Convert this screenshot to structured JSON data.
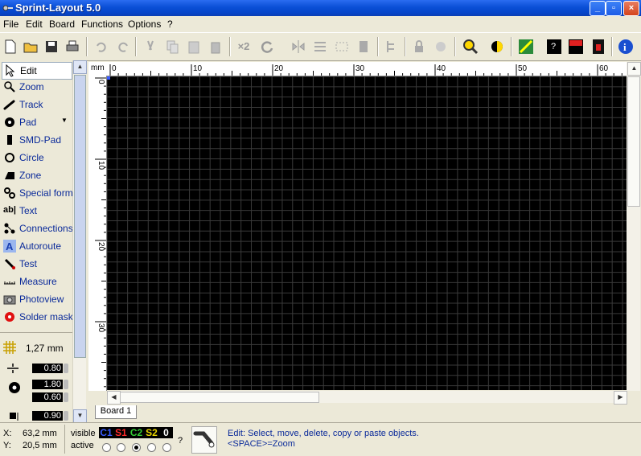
{
  "window": {
    "title": "Sprint-Layout 5.0",
    "buttons": [
      "_",
      "▫",
      "×"
    ]
  },
  "menu": [
    "File",
    "Edit",
    "Board",
    "Functions",
    "Options",
    "?"
  ],
  "toolbar": {
    "x2_label": "×2"
  },
  "tools": [
    {
      "label": "Edit",
      "icon": "arrow-cursor-icon",
      "active": true
    },
    {
      "label": "Zoom",
      "icon": "magnifier-icon"
    },
    {
      "label": "Track",
      "icon": "track-icon"
    },
    {
      "label": "Pad",
      "icon": "pad-icon",
      "has_menu": true
    },
    {
      "label": "SMD-Pad",
      "icon": "smd-pad-icon"
    },
    {
      "label": "Circle",
      "icon": "circle-icon"
    },
    {
      "label": "Zone",
      "icon": "zone-icon"
    },
    {
      "label": "Special form",
      "icon": "special-form-icon"
    },
    {
      "label": "Text",
      "icon": "text-icon"
    },
    {
      "label": "Connections",
      "icon": "connections-icon"
    },
    {
      "label": "Autoroute",
      "icon": "autoroute-icon"
    },
    {
      "label": "Test",
      "icon": "test-icon"
    },
    {
      "label": "Measure",
      "icon": "measure-icon"
    },
    {
      "label": "Photoview",
      "icon": "camera-icon"
    },
    {
      "label": "Solder mask",
      "icon": "solder-mask-icon"
    }
  ],
  "grid_setting": {
    "value": "1,27 mm"
  },
  "params": [
    {
      "value": "0.80",
      "icon": "track-width-icon"
    },
    {
      "value": "1.80",
      "icon": "pad-outer-icon"
    },
    {
      "value": "0.60",
      "icon": "pad-drill-icon"
    },
    {
      "value": "0.90",
      "icon": "smd-size-icon"
    }
  ],
  "ruler": {
    "unit": "mm",
    "top_labels": [
      "0",
      "10",
      "20",
      "30",
      "40",
      "50",
      "60"
    ],
    "left_labels": [
      "0",
      "10",
      "20",
      "30"
    ]
  },
  "board_tab": "Board 1",
  "status": {
    "x_label": "X:",
    "x_value": "63,2 mm",
    "y_label": "Y:",
    "y_value": "20,5 mm",
    "visible_label": "visible",
    "active_label": "active",
    "layers": [
      {
        "name": "C1",
        "color": "#3a5cff"
      },
      {
        "name": "S1",
        "color": "#ff2a2a"
      },
      {
        "name": "C2",
        "color": "#33cc33"
      },
      {
        "name": "S2",
        "color": "#e8d400"
      },
      {
        "name": "0",
        "color": "#ffffff"
      }
    ],
    "active_layer": "C2",
    "question": "?",
    "hint_line1": "Edit: Select, move, delete, copy or paste objects.",
    "hint_line2": "<SPACE>=Zoom"
  },
  "colors": {
    "canvas_bg": "#000000",
    "grid": "#3a3a3a",
    "accent": "#0a2a9a"
  }
}
